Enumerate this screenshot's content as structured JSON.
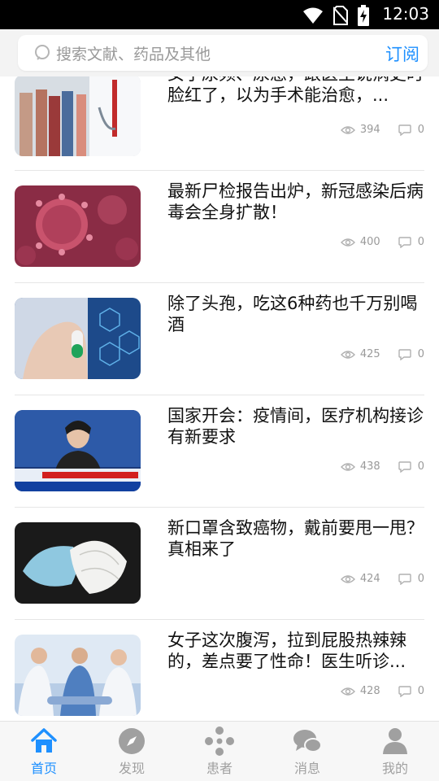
{
  "status_bar": {
    "time": "12:03",
    "icons": [
      "wifi-icon",
      "no-sim-icon",
      "battery-charging-icon"
    ]
  },
  "search": {
    "placeholder": "搜索文献、药品及其他",
    "subscribe_label": "订阅"
  },
  "articles": [
    {
      "title": "女子尿频、尿急，跟医生说病史时脸红了，以为手术能治愈，...",
      "views": "394",
      "comments": "0",
      "thumb": "doctor-and-people-photo"
    },
    {
      "title": "最新尸检报告出炉，新冠感染后病毒会全身扩散！",
      "views": "400",
      "comments": "0",
      "thumb": "virus-photo"
    },
    {
      "title": "除了头孢，吃这6种药也千万别喝酒",
      "views": "425",
      "comments": "0",
      "thumb": "capsule-photo"
    },
    {
      "title": "国家开会：疫情间，医疗机构接诊有新要求",
      "views": "438",
      "comments": "0",
      "thumb": "news-broadcast-photo"
    },
    {
      "title": "新口罩含致癌物，戴前要甩一甩？真相来了",
      "views": "424",
      "comments": "0",
      "thumb": "masks-photo"
    },
    {
      "title": "女子这次腹泻，拉到屁股热辣辣的，差点要了性命！医生听诊...",
      "views": "428",
      "comments": "0",
      "thumb": "medical-team-photo"
    }
  ],
  "tabs": [
    {
      "label": "首页",
      "icon": "home-icon",
      "active": true
    },
    {
      "label": "发现",
      "icon": "compass-icon",
      "active": false
    },
    {
      "label": "患者",
      "icon": "patients-network-icon",
      "active": false
    },
    {
      "label": "消息",
      "icon": "chat-bubbles-icon",
      "active": false
    },
    {
      "label": "我的",
      "icon": "profile-icon",
      "active": false
    }
  ],
  "colors": {
    "accent": "#1e90ff",
    "inactive": "#a0a0a0"
  }
}
